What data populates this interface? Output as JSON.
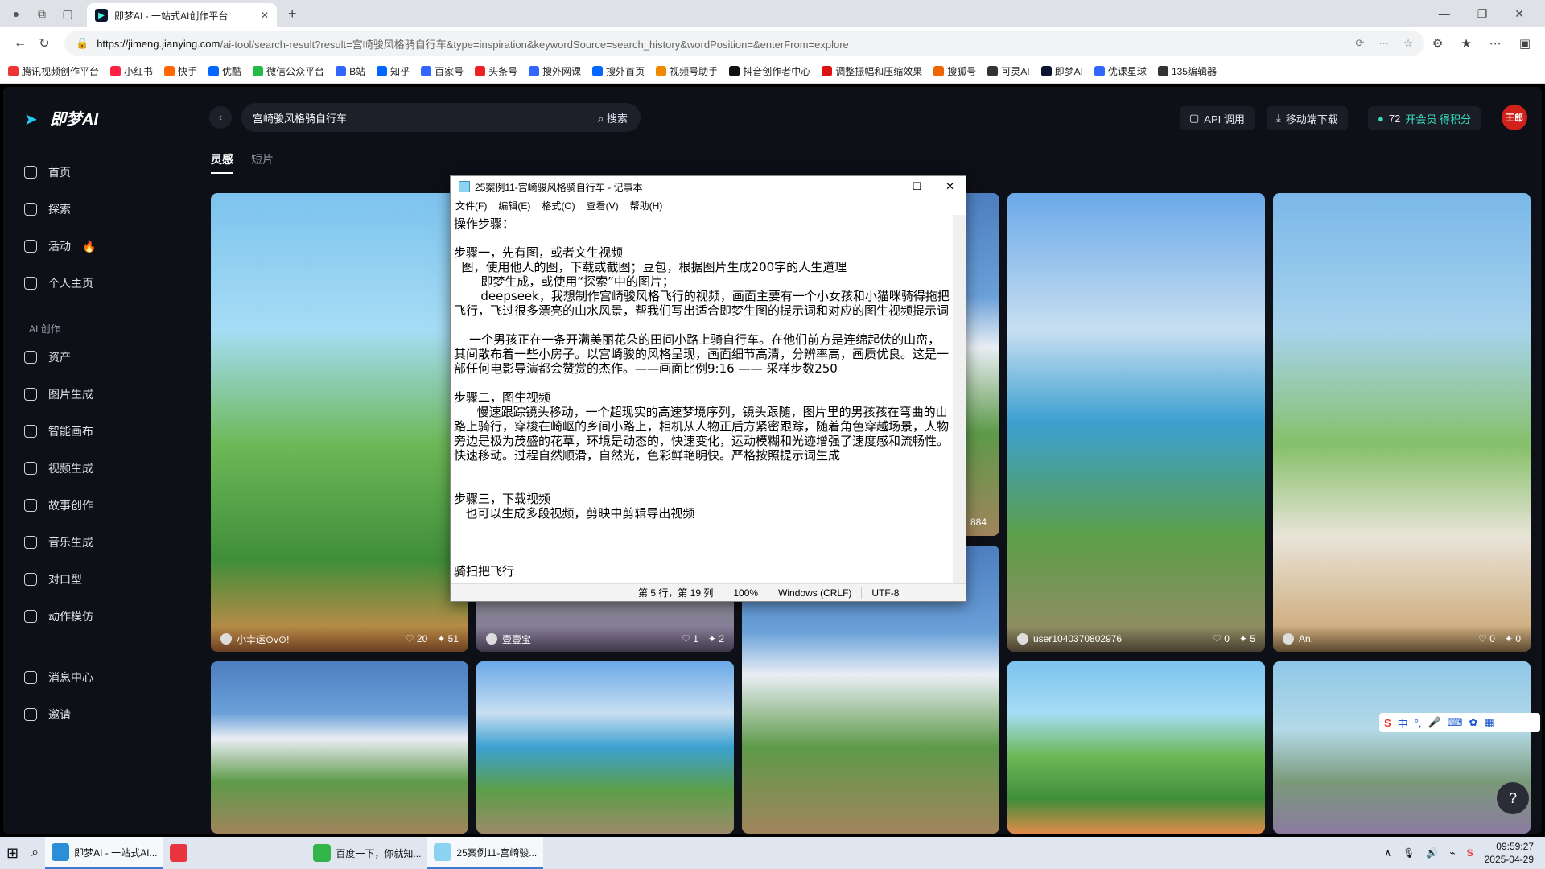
{
  "browser": {
    "tab_title": "即梦AI - 一站式AI创作平台",
    "url_host": "https://jimeng.jianying.com",
    "url_path": "/ai-tool/search-result?result=宫崎骏风格骑自行车&type=inspiration&keywordSource=search_history&wordPosition=&enterFrom=explore",
    "bookmarks": [
      "腾讯视频创作平台",
      "小红书",
      "快手",
      "优酷",
      "微信公众平台",
      "B站",
      "知乎",
      "百家号",
      "头条号",
      "搜外网课",
      "搜外首页",
      "视频号助手",
      "抖音创作者中心",
      "调整振幅和压缩效果",
      "搜狐号",
      "可灵AI",
      "即梦AI",
      "优课星球",
      "135编辑器"
    ]
  },
  "app": {
    "logo": "即梦AI",
    "nav": [
      "首页",
      "探索",
      "活动",
      "个人主页"
    ],
    "section_label": "AI 创作",
    "nav2": [
      "资产",
      "图片生成",
      "智能画布",
      "视频生成",
      "故事创作",
      "音乐生成",
      "对口型",
      "动作模仿"
    ],
    "nav3": [
      "消息中心",
      "邀请"
    ],
    "search_value": "宫崎骏风格骑自行车",
    "search_button": "搜索",
    "api_label": "API 调用",
    "download_label": "移动端下载",
    "points": "72",
    "vip_label": "开会员 得积分",
    "avatar_text": "王郎",
    "tabs": [
      "灵感",
      "短片"
    ],
    "cards": [
      {
        "user": "小幸运⊙v⊙!",
        "likes": "20",
        "uses": "51"
      },
      {
        "user": "壹壹宝",
        "likes": "1",
        "uses": "2"
      },
      {
        "user": "user1040370802976",
        "likes": "0",
        "uses": "5"
      },
      {
        "user": "An.",
        "likes": "0",
        "uses": "0"
      }
    ],
    "hidden_count": "884",
    "help": "?"
  },
  "notepad": {
    "title": "25案例11-宫崎骏风格骑自行车 - 记事本",
    "menu": [
      "文件(F)",
      "编辑(E)",
      "格式(O)",
      "查看(V)",
      "帮助(H)"
    ],
    "content": "操作步骤：\n\n步骤一，先有图，或者文生视频\n  图，使用他人的图，下载或截图；豆包，根据图片生成200字的人生道理\n       即梦生成，或使用“探索”中的图片；\n       deepseek，我想制作宫崎骏风格飞行的视频，画面主要有一个小女孩和小猫咪骑得拖把飞行，飞过很多漂亮的山水风景，帮我们写出适合即梦生图的提示词和对应的图生视频提示词\n\n    一个男孩正在一条开满美丽花朵的田间小路上骑自行车。在他们前方是连绵起伏的山峦，其间散布着一些小房子。以宫崎骏的风格呈现，画面细节高清，分辨率高，画质优良。这是一部任何电影导演都会赞赏的杰作。——画面比例9:16 —— 采样步数250\n\n步骤二，图生视频\n      慢速跟踪镜头移动，一个超现实的高速梦境序列，镜头跟随，图片里的男孩孩在弯曲的山路上骑行，穿梭在崎岖的乡间小路上，相机从人物正后方紧密跟踪，随着角色穿越场景，人物旁边是极为茂盛的花草，环境是动态的，快速变化，运动模糊和光迹增强了速度感和流畅性。快速移动。过程自然顺滑，自然光，色彩鲜艳明快。严格按照提示词生成\n\n\n步骤三，下载视频\n   也可以生成多段视频，剪映中剪辑导出视频\n\n\n\n骑扫把飞行",
    "status_pos": "第 5 行，第 19 列",
    "status_zoom": "100%",
    "status_eol": "Windows (CRLF)",
    "status_enc": "UTF-8"
  },
  "taskbar": {
    "items": [
      "即梦AI - 一站式AI...",
      "",
      "百度一下，你就知...",
      "25案例11-宫崎骏..."
    ],
    "time": "09:59:27",
    "date": "2025-04-29"
  },
  "ime": {
    "label": "中"
  }
}
